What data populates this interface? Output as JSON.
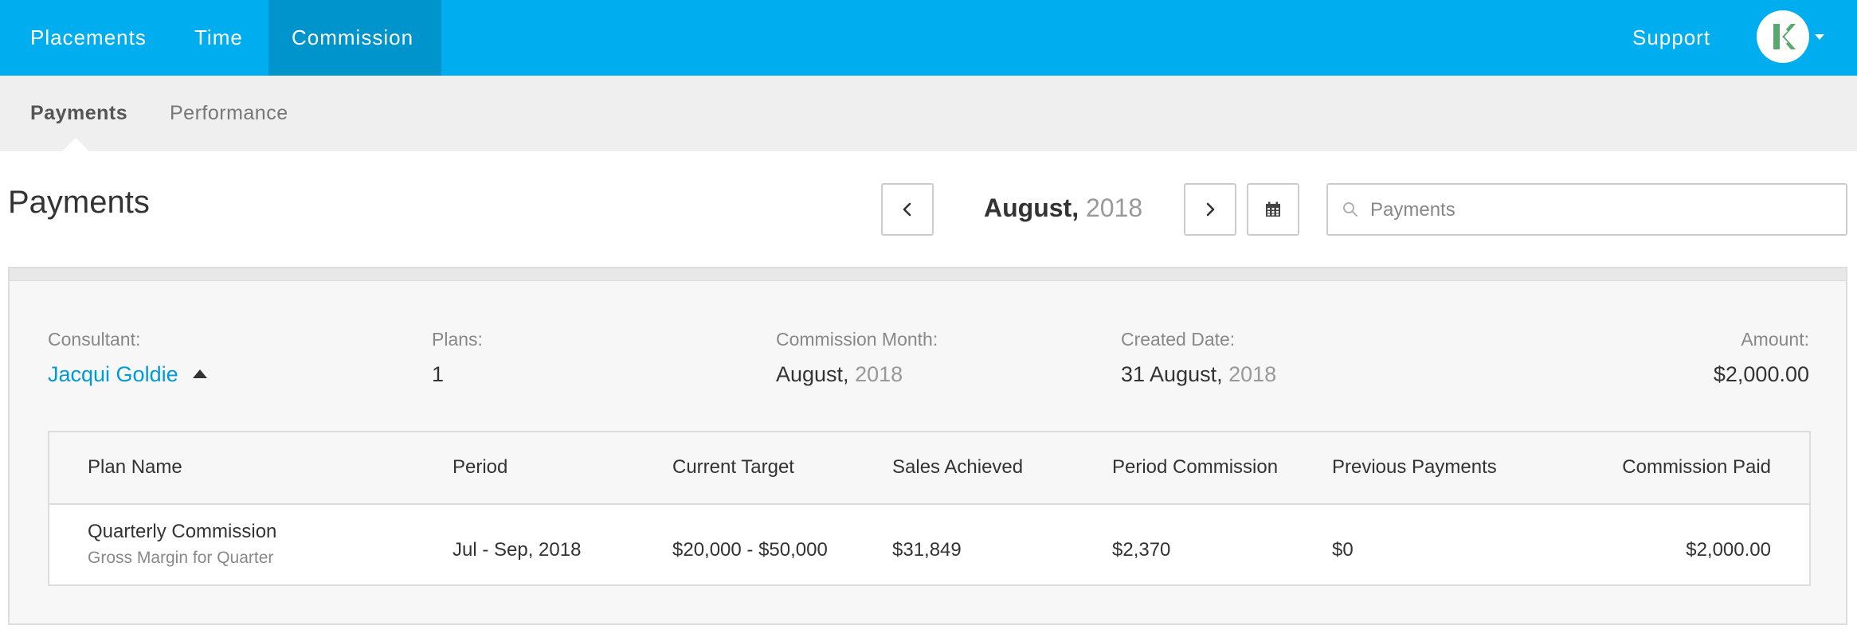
{
  "topnav": {
    "items": [
      {
        "label": "Placements"
      },
      {
        "label": "Time"
      },
      {
        "label": "Commission"
      }
    ],
    "support_label": "Support",
    "avatar_icon": "k-logo-icon",
    "accent": "#00aeef",
    "active_bg": "#0094cc"
  },
  "subnav": {
    "items": [
      {
        "label": "Payments"
      },
      {
        "label": "Performance"
      }
    ]
  },
  "header": {
    "title": "Payments",
    "month": "August,",
    "year": "2018",
    "search_placeholder": "Payments",
    "search_value": ""
  },
  "payment": {
    "consultant_label": "Consultant:",
    "consultant_name": "Jacqui Goldie",
    "plans_label": "Plans:",
    "plans_value": "1",
    "commission_month_label": "Commission Month:",
    "commission_month": "August,",
    "commission_year": "2018",
    "created_date_label": "Created Date:",
    "created_date": "31 August,",
    "created_year": "2018",
    "amount_label": "Amount:",
    "amount_value": "$2,000.00"
  },
  "table": {
    "headers": [
      "Plan Name",
      "Period",
      "Current Target",
      "Sales Achieved",
      "Period Commission",
      "Previous Payments",
      "Commission Paid"
    ],
    "rows": [
      {
        "plan_name": "Quarterly Commission",
        "plan_sub": "Gross Margin for Quarter",
        "period": "Jul - Sep, 2018",
        "current_target": "$20,000 - $50,000",
        "sales_achieved": "$31,849",
        "period_commission": "$2,370",
        "previous_payments": "$0",
        "commission_paid": "$2,000.00"
      }
    ]
  },
  "colors": {
    "link": "#0099d9",
    "muted": "#999999"
  }
}
